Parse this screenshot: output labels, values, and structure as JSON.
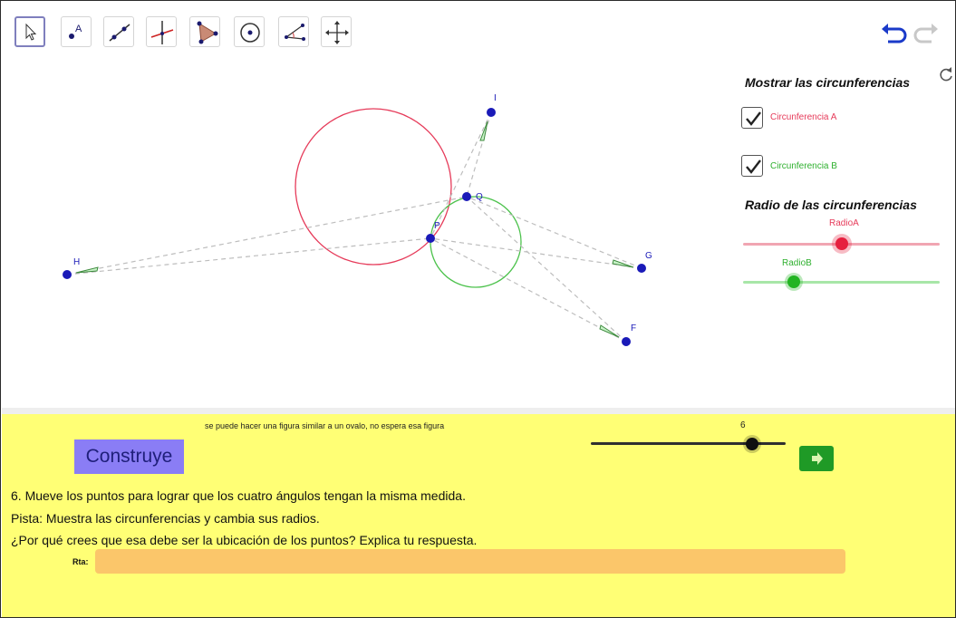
{
  "toolbar": {
    "tools": [
      "move-tool",
      "point-tool",
      "line-tool",
      "perpendicular-tool",
      "polygon-tool",
      "circle-tool",
      "angle-tool",
      "move-graphics-tool"
    ],
    "active_tool": "move-tool",
    "undo_icon": "undo-icon",
    "redo_icon": "redo-icon"
  },
  "graphics": {
    "points": {
      "I": "I",
      "Q": "Q",
      "P": "P",
      "H": "H",
      "G": "G",
      "F": "F"
    },
    "colors": {
      "point": "#1a1ab8",
      "circle_a": "#e63b5a",
      "circle_b": "#4cc24c",
      "dashed": "#bdbdbd"
    }
  },
  "panel": {
    "show_title": "Mostrar las circunferencias",
    "circle_a_label": "Circunferencia A",
    "circle_a_checked": true,
    "circle_b_label": "Circunferencia B",
    "circle_b_checked": true,
    "radius_title": "Radio de las circunferencias",
    "radio_a_label": "RadioA",
    "radio_b_label": "RadioB",
    "refresh_icon": "refresh-icon"
  },
  "bottom": {
    "note": "se puede hacer una figura similar a un ovalo, no espera esa figura",
    "construye": "Construye",
    "step_value": "6",
    "next_icon": "arrow-right-icon",
    "line1": "6. Mueve los puntos para lograr que los cuatro ángulos tengan la misma medida.",
    "line2": "Pista: Muestra las circunferencias y cambia sus radios.",
    "line3": "¿Por qué crees que esa debe ser la ubicación de los puntos? Explica tu respuesta.",
    "rta_label": "Rta:",
    "rta_value": ""
  }
}
